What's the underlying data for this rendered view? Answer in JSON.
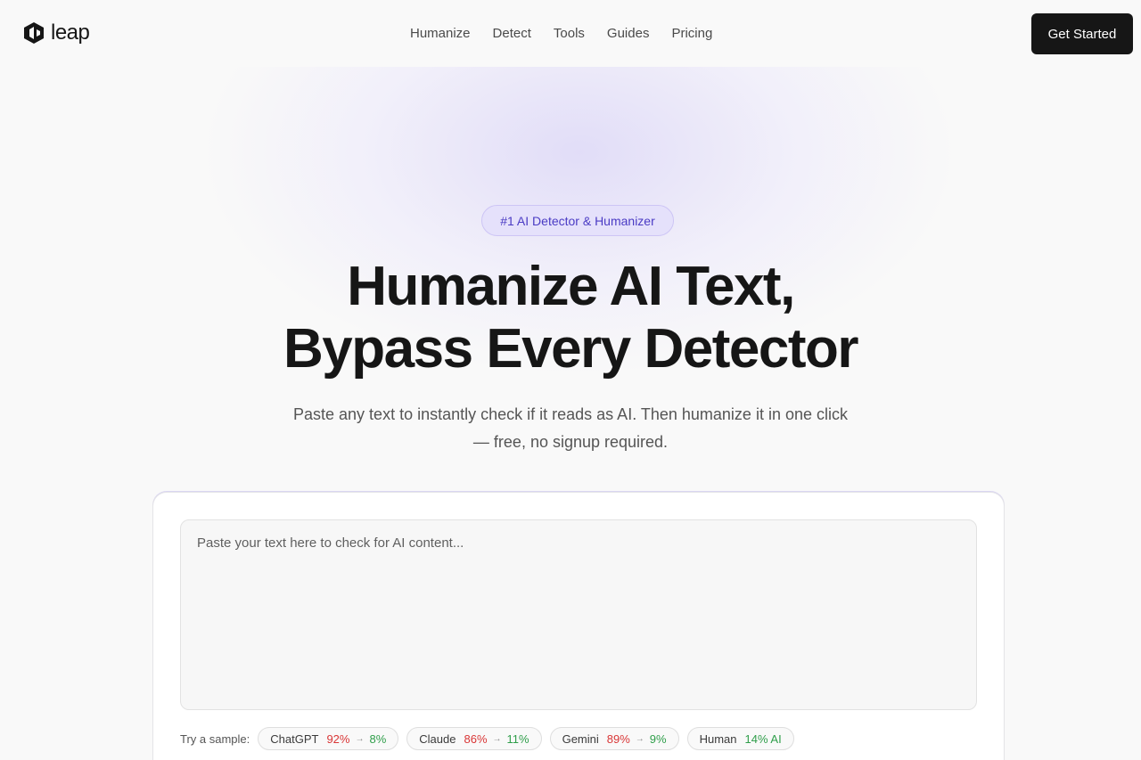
{
  "brand": {
    "name": "leap"
  },
  "nav": {
    "links": [
      "Humanize",
      "Detect",
      "Tools",
      "Guides",
      "Pricing"
    ],
    "cta_label": "Get Started"
  },
  "hero": {
    "badge": "#1 AI Detector & Humanizer",
    "headline_line1": "Humanize AI Text,",
    "headline_line2": "Bypass Every Detector",
    "subtitle": "Paste any text to instantly check if it reads as AI. Then humanize it in one click — free, no signup required."
  },
  "editor": {
    "placeholder": "Paste your text here to check for AI content...",
    "value": "",
    "samples_label": "Try a sample:",
    "samples": [
      {
        "name": "ChatGPT",
        "before": "92%",
        "arrow": "→",
        "after": "8%"
      },
      {
        "name": "Claude",
        "before": "86%",
        "arrow": "→",
        "after": "11%"
      },
      {
        "name": "Gemini",
        "before": "89%",
        "arrow": "→",
        "after": "9%"
      },
      {
        "name": "Human",
        "after": "14% AI"
      }
    ]
  },
  "colors": {
    "accent": "#4a3bc4",
    "badge_bg": "#e5e1fb",
    "cta_bg": "#161616",
    "ai_score": "#d93636",
    "human_score": "#2f9e4a"
  },
  "icons": {
    "logo": "leap-hexagon-logo-icon"
  }
}
